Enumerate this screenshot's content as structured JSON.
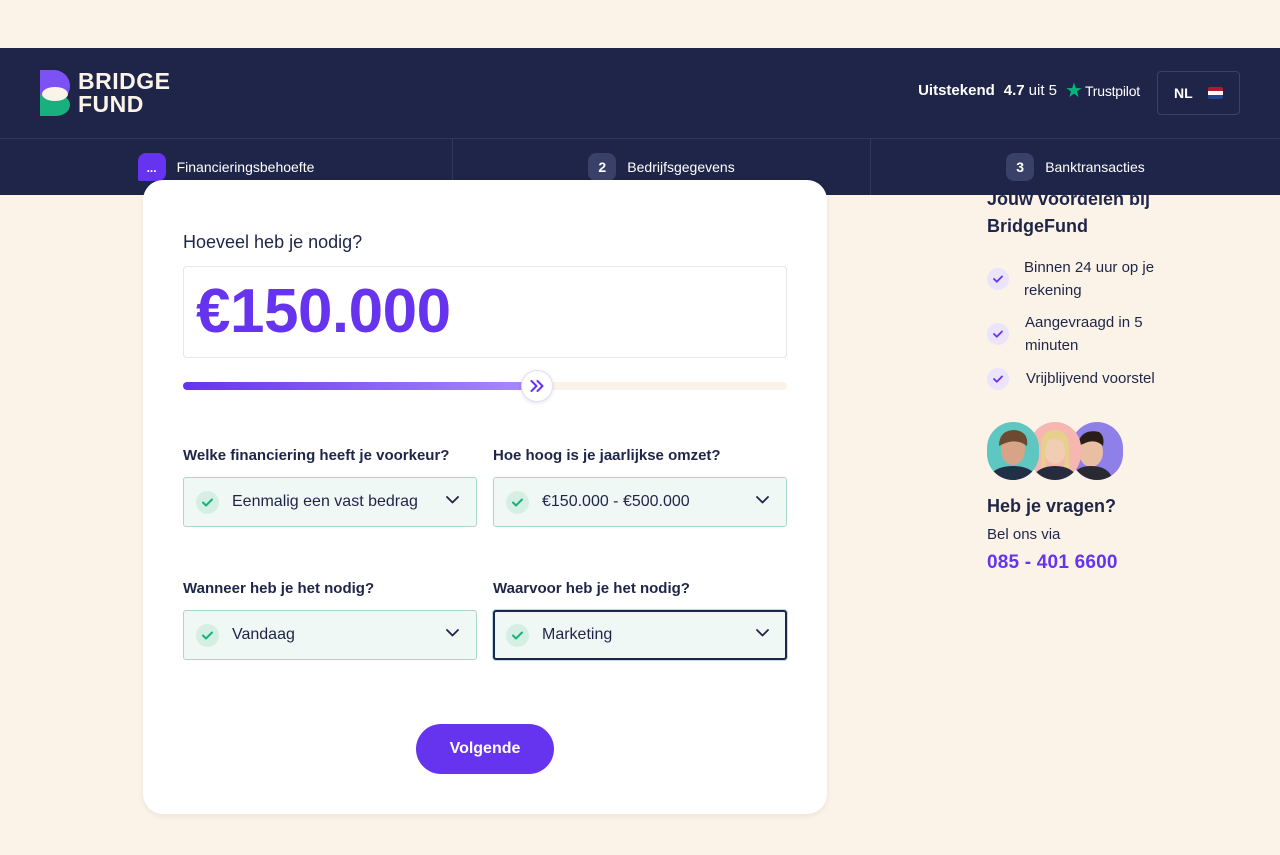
{
  "brand": {
    "logo_line1": "BRIDGE",
    "logo_line2": "FUND",
    "colors": {
      "navy": "#1e2548",
      "purple": "#6633ee",
      "green": "#19b07f",
      "cream": "#fcf3e8"
    }
  },
  "header": {
    "rating_label": "Uitstekend",
    "rating_score": "4.7",
    "rating_of": "uit 5",
    "trustpilot_label": "Trustpilot",
    "language": "NL",
    "flag_icon": "netherlands-flag-icon"
  },
  "steps": [
    {
      "number": "...",
      "label": "Financieringsbehoefte",
      "active": true
    },
    {
      "number": "2",
      "label": "Bedrijfsgegevens",
      "active": false
    },
    {
      "number": "3",
      "label": "Banktransacties",
      "active": false
    }
  ],
  "form": {
    "amount_question": "Hoeveel heb je nodig?",
    "amount_value": "€150.000",
    "slider_level": 0.586,
    "fields": [
      {
        "label": "Welke financiering heeft je voorkeur?",
        "value": "Eenmalig een vast bedrag"
      },
      {
        "label": "Hoe hoog is je jaarlijkse omzet?",
        "value": "€150.000 - €500.000"
      },
      {
        "label": "Wanneer heb je het nodig?",
        "value": "Vandaag"
      },
      {
        "label": "Waarvoor heb je het nodig?",
        "value": "Marketing"
      }
    ],
    "next_button": "Volgende"
  },
  "sidebar": {
    "title_line1": "Jouw voordelen bij",
    "title_line2": "BridgeFund",
    "benefits": [
      {
        "line1": "Binnen 24 uur op je",
        "line2": "rekening"
      },
      {
        "line1": "Aangevraagd in 5",
        "line2": "minuten"
      },
      {
        "line1": "Vrijblijvend voorstel",
        "line2": ""
      }
    ],
    "questions_title": "Heb je vragen?",
    "call_text": "Bel ons via",
    "phone": "085 - 401 6600"
  }
}
